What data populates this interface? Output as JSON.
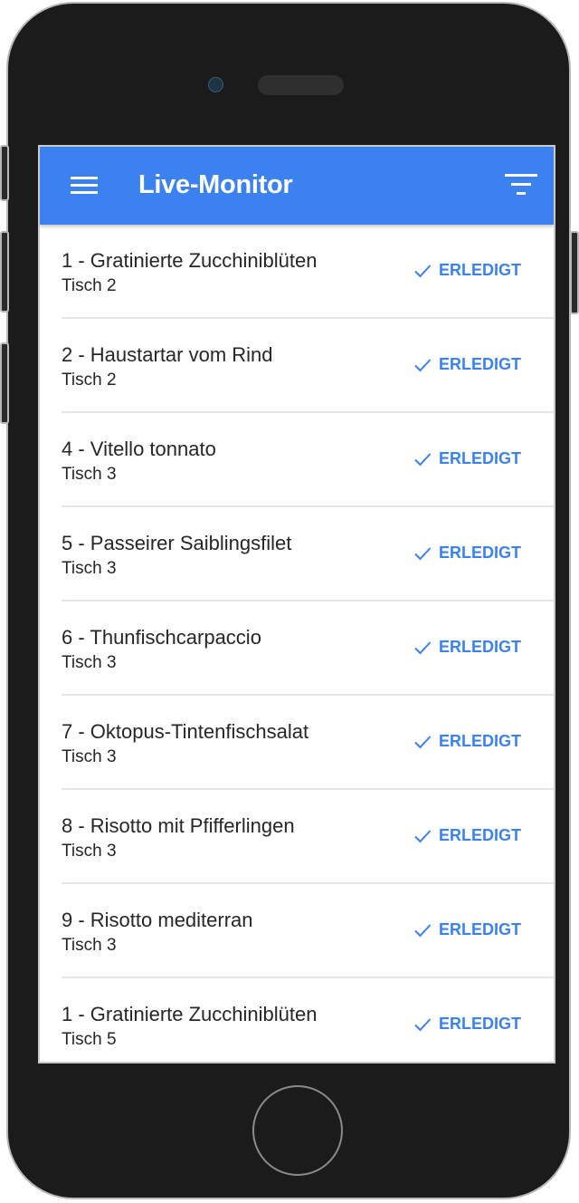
{
  "app": {
    "title": "Live-Monitor",
    "accent_color": "#3b82f0"
  },
  "icons": {
    "menu": "hamburger-menu-icon",
    "filter": "filter-icon",
    "check": "check-icon"
  },
  "orders": [
    {
      "title": "1 - Gratinierte Zucchiniblüten",
      "table": "Tisch 2",
      "action": "ERLEDIGT"
    },
    {
      "title": "2 - Haustartar vom Rind",
      "table": "Tisch 2",
      "action": "ERLEDIGT"
    },
    {
      "title": "4 - Vitello tonnato",
      "table": "Tisch 3",
      "action": "ERLEDIGT"
    },
    {
      "title": "5 - Passeirer Saiblingsfilet",
      "table": "Tisch 3",
      "action": "ERLEDIGT"
    },
    {
      "title": "6 - Thunfischcarpaccio",
      "table": "Tisch 3",
      "action": "ERLEDIGT"
    },
    {
      "title": "7 - Oktopus-Tintenfischsalat",
      "table": "Tisch 3",
      "action": "ERLEDIGT"
    },
    {
      "title": "8 - Risotto mit Pfifferlingen",
      "table": "Tisch 3",
      "action": "ERLEDIGT"
    },
    {
      "title": "9 - Risotto mediterran",
      "table": "Tisch 3",
      "action": "ERLEDIGT"
    },
    {
      "title": "1 - Gratinierte Zucchiniblüten",
      "table": "Tisch 5",
      "action": "ERLEDIGT"
    }
  ]
}
